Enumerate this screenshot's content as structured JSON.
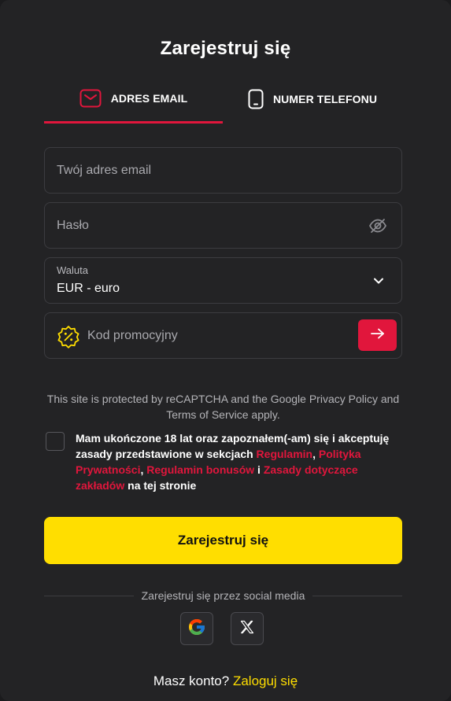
{
  "modal": {
    "title": "Zarejestruj się"
  },
  "tabs": [
    {
      "label": "ADRES EMAIL",
      "icon": "mail-icon",
      "active": true
    },
    {
      "label": "NUMER TELEFONU",
      "icon": "phone-icon",
      "active": false
    }
  ],
  "form": {
    "email": {
      "placeholder": "Twój adres email",
      "value": ""
    },
    "password": {
      "placeholder": "Hasło",
      "value": "",
      "toggle_icon": "eye-off-icon"
    },
    "currency": {
      "label": "Waluta",
      "value": "EUR - euro",
      "icon": "chevron-down-icon"
    },
    "promo": {
      "placeholder": "Kod promocyjny",
      "value": "",
      "icon": "percent-badge-icon",
      "submit_icon": "arrow-right-icon"
    }
  },
  "recaptcha_text": "This site is protected by reCAPTCHA and the Google Privacy Policy and Terms of Service apply.",
  "consent": {
    "checked": false,
    "text_before": "Mam ukończone 18 lat oraz zapoznałem(-am) się i akceptuję zasady przedstawione w sekcjach ",
    "link_terms": "Regulamin",
    "sep1": ", ",
    "link_privacy": "Polityka Prywatności",
    "sep2": ", ",
    "link_bonus_terms": "Regulamin bonusów",
    "sep3": " i ",
    "link_betting_rules": "Zasady dotyczące zakładów",
    "text_after": " na tej stronie"
  },
  "submit_label": "Zarejestruj się",
  "social": {
    "divider_text": "Zarejestruj się przez social media",
    "providers": [
      {
        "name": "Google",
        "icon": "google-icon"
      },
      {
        "name": "X",
        "icon": "x-icon"
      }
    ]
  },
  "login": {
    "prompt": "Masz konto?",
    "link": "Zaloguj się"
  },
  "colors": {
    "background": "#232325",
    "accent_red": "#e1163c",
    "accent_yellow": "#ffde00",
    "border": "#3c3c40"
  }
}
